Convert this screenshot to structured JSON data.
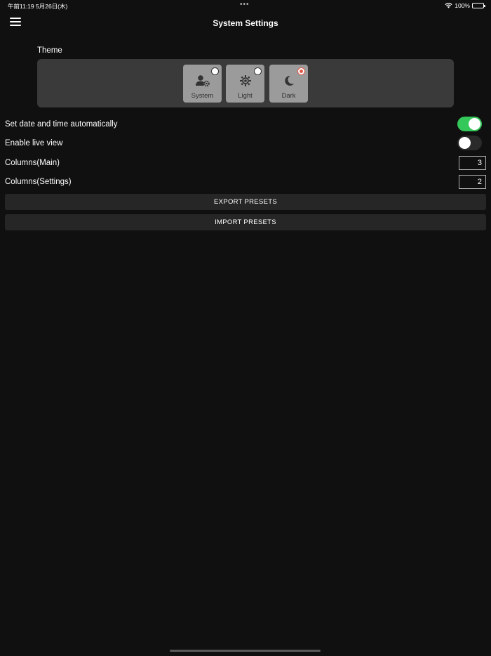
{
  "status_bar": {
    "time": "午前11:19 5月26日(木)",
    "dots": "•••",
    "battery": "100%"
  },
  "header": {
    "title": "System Settings"
  },
  "theme": {
    "label": "Theme",
    "options": [
      {
        "label": "System",
        "icon": "user-gear-icon",
        "selected": false
      },
      {
        "label": "Light",
        "icon": "sun-icon",
        "selected": false
      },
      {
        "label": "Dark",
        "icon": "moon-icon",
        "selected": true
      }
    ]
  },
  "settings": {
    "auto_datetime": {
      "label": "Set date and time automatically",
      "enabled": true
    },
    "live_view": {
      "label": "Enable live view",
      "enabled": false
    },
    "columns_main": {
      "label": "Columns(Main)",
      "value": "3"
    },
    "columns_settings": {
      "label": "Columns(Settings)",
      "value": "2"
    }
  },
  "actions": {
    "export_label": "EXPORT PRESETS",
    "import_label": "IMPORT PRESETS"
  },
  "colors": {
    "background": "#101010",
    "toggle_on": "#34c759",
    "selected_radio": "#e05a4a"
  }
}
